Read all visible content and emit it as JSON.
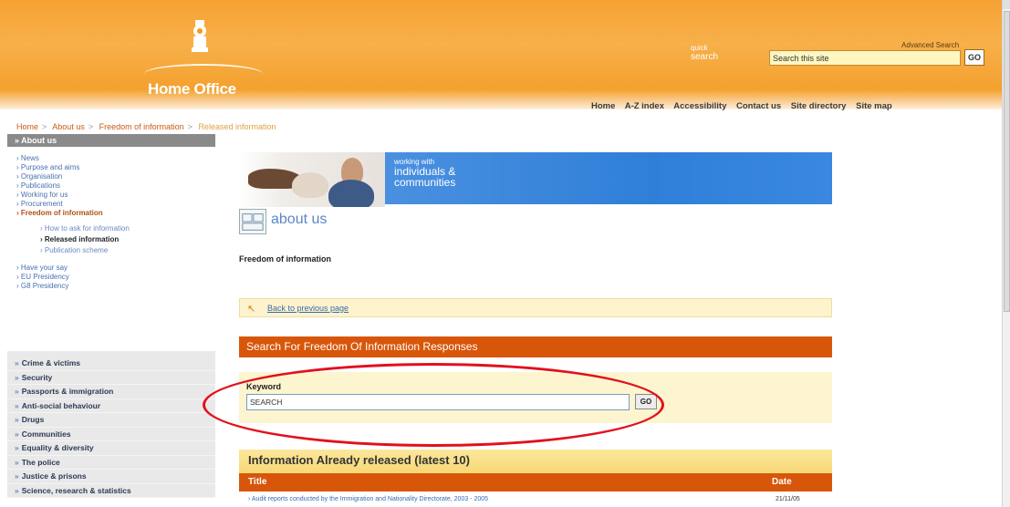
{
  "header": {
    "logo_text": "Home Office",
    "quick_search_small": "quick",
    "quick_search_big": "search",
    "search_value": "Search this site",
    "go_label": "GO",
    "advanced_search": "Advanced Search",
    "nav": [
      "Home",
      "A-Z index",
      "Accessibility",
      "Contact us",
      "Site directory",
      "Site map"
    ]
  },
  "breadcrumb": [
    "Home",
    "About us",
    "Freedom of information",
    "Released information"
  ],
  "sidebar": {
    "heading": "About us",
    "items": [
      "News",
      "Purpose and aims",
      "Organisation",
      "Publications",
      "Working for us",
      "Procurement",
      "Freedom of information"
    ],
    "sub_items": [
      "How to ask for information",
      "Released information",
      "Publication scheme"
    ],
    "items2": [
      "Have your say",
      "EU Presidency",
      "G8 Presidency"
    ],
    "categories": [
      "Crime & victims",
      "Security",
      "Passports & immigration",
      "Anti-social behaviour",
      "Drugs",
      "Communities",
      "Equality & diversity",
      "The police",
      "Justice & prisons",
      "Science, research & statistics"
    ]
  },
  "banner": {
    "line1": "working with",
    "line2": "individuals &",
    "line3": "communities"
  },
  "page": {
    "section_title": "about us",
    "heading": "Freedom of information",
    "back_link": "Back to previous page"
  },
  "search": {
    "bar_title": "Search For Freedom Of Information Responses",
    "keyword_label": "Keyword",
    "keyword_value": "SEARCH",
    "go_label": "GO"
  },
  "released": {
    "title": "Information Already released (latest 10)",
    "col_title": "Title",
    "col_date": "Date",
    "rows": [
      {
        "title": "Audit reports conducted by the Immigration and Nationality Directorate, 2003 - 2005",
        "date": "21/11/05"
      }
    ]
  },
  "colors": {
    "header_orange": "#f6a233",
    "bar_orange": "#d8560a",
    "panel_cream": "#fdf5cf",
    "annotation_red": "#e2101c"
  }
}
